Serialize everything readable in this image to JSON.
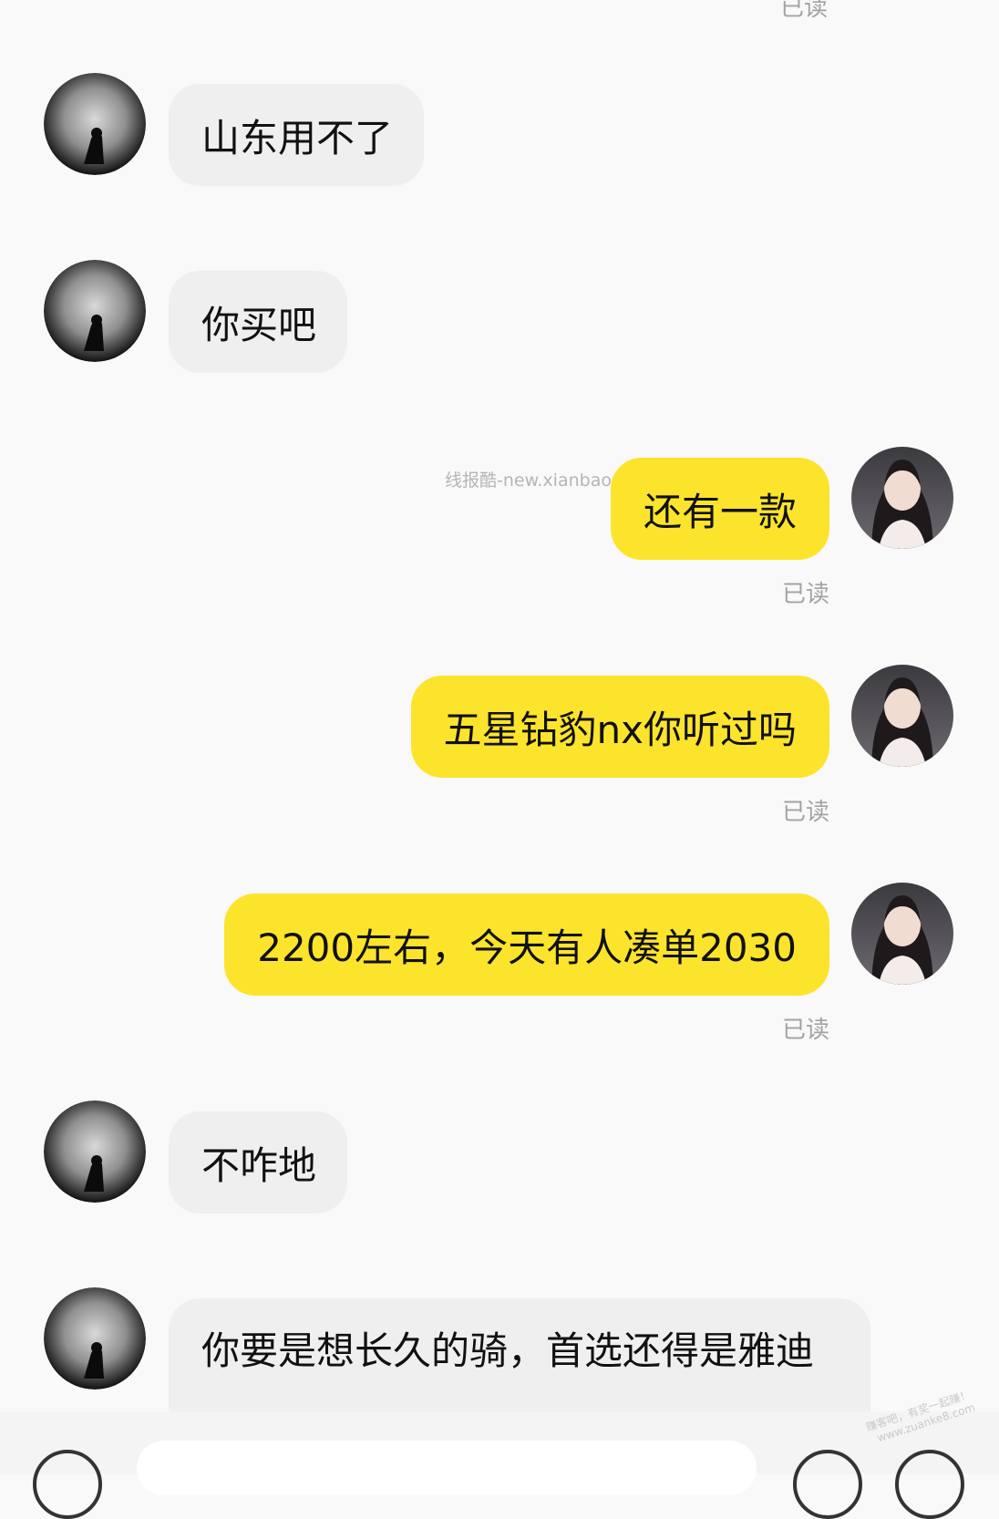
{
  "messages": [
    {
      "side": "in",
      "text": "山东用不了",
      "avatar": "dark-silhouette-avatar"
    },
    {
      "side": "in",
      "text": "你买吧",
      "avatar": "dark-silhouette-avatar"
    },
    {
      "side": "out",
      "text": "还有一款",
      "status": "已读",
      "avatar": "girl-portrait-avatar"
    },
    {
      "side": "out",
      "text": "五星钻豹nx你听过吗",
      "status": "已读",
      "avatar": "girl-portrait-avatar"
    },
    {
      "side": "out",
      "text": "2200左右，今天有人凑单2030",
      "status": "已读",
      "avatar": "girl-portrait-avatar"
    },
    {
      "side": "in",
      "text": "不咋地",
      "avatar": "dark-silhouette-avatar"
    },
    {
      "side": "in",
      "text": "你要是想长久的骑，首选还得是雅迪",
      "avatar": "dark-silhouette-avatar"
    }
  ],
  "top_read_status": "已读",
  "watermark": "线报酷-new.xianbao.fun",
  "corner_watermark": {
    "line1": "赚客吧，有奖一起赚！",
    "line2": "www.zuanke8.com"
  },
  "colors": {
    "outgoing_bubble": "#fde42c",
    "incoming_bubble": "#efefef",
    "background": "#f9f9f9",
    "status_text": "#a3a3a3"
  },
  "icons": [
    "voice-icon",
    "emoji-icon",
    "plus-icon"
  ]
}
